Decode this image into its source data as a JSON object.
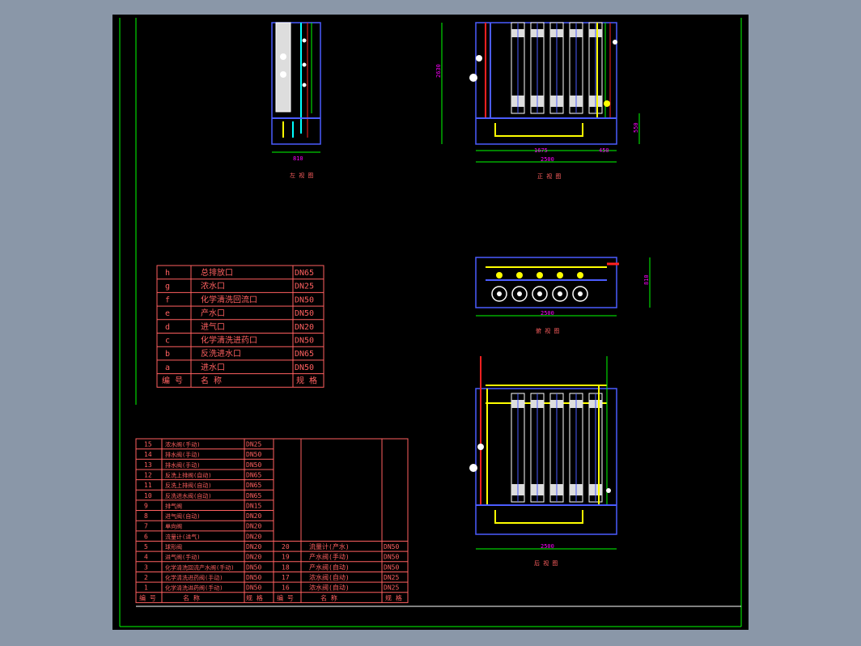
{
  "colors": {
    "background": "#8a97a8",
    "sheet": "#000000",
    "frame": "#00ff00",
    "table": "#ff6060",
    "text": "#ff6060",
    "dim": "#00ff00",
    "dim_text": "#ff00ff",
    "pipe_blue": "#4b5cff",
    "pipe_yellow": "#ffff00",
    "pipe_cyan": "#00ffff",
    "white": "#ffffff"
  },
  "views": {
    "left_view": {
      "title": "左 视 图",
      "dim_width": "810"
    },
    "front_view": {
      "title": "正 视 图",
      "dim_height": "2630",
      "dim_base": "550",
      "dim_a": "1675",
      "dim_b": "450",
      "dim_total": "2500"
    },
    "top_view": {
      "title": "俯 视 图",
      "dim_total": "2500",
      "dim_side": "810"
    },
    "back_view": {
      "title": "后 视 图",
      "dim_total": "2500"
    }
  },
  "interface_table": {
    "header": {
      "code": "编 号",
      "name": "名 称",
      "spec": "规 格"
    },
    "rows": [
      {
        "code": "h",
        "name": "总排放口",
        "spec": "DN65"
      },
      {
        "code": "g",
        "name": "浓水口",
        "spec": "DN25"
      },
      {
        "code": "f",
        "name": "化学清洗回流口",
        "spec": "DN50"
      },
      {
        "code": "e",
        "name": "产水口",
        "spec": "DN50"
      },
      {
        "code": "d",
        "name": "进气口",
        "spec": "DN20"
      },
      {
        "code": "c",
        "name": "化学清洗进药口",
        "spec": "DN50"
      },
      {
        "code": "b",
        "name": "反洗进水口",
        "spec": "DN65"
      },
      {
        "code": "a",
        "name": "进水口",
        "spec": "DN50"
      }
    ]
  },
  "parts_table": {
    "header": {
      "no": "编 号",
      "name": "名 称",
      "spec": "规 格",
      "no2": "编 号",
      "name2": "名 称",
      "spec2": "规 格"
    },
    "left": [
      {
        "no": "15",
        "name": "浓水阀(手动)",
        "spec": "DN25"
      },
      {
        "no": "14",
        "name": "排水阀(手动)",
        "spec": "DN50"
      },
      {
        "no": "13",
        "name": "排水阀(手动)",
        "spec": "DN50"
      },
      {
        "no": "12",
        "name": "反洗上排阀(自动)",
        "spec": "DN65"
      },
      {
        "no": "11",
        "name": "反洗上排阀(自动)",
        "spec": "DN65"
      },
      {
        "no": "10",
        "name": "反洗进水阀(自动)",
        "spec": "DN65"
      },
      {
        "no": "9",
        "name": "排气阀",
        "spec": "DN15"
      },
      {
        "no": "8",
        "name": "进气阀(自动)",
        "spec": "DN20"
      },
      {
        "no": "7",
        "name": "单向阀",
        "spec": "DN20"
      },
      {
        "no": "6",
        "name": "流量计(进气)",
        "spec": "DN20"
      },
      {
        "no": "5",
        "name": "球形阀",
        "spec": "DN20"
      },
      {
        "no": "4",
        "name": "进气阀(手动)",
        "spec": "DN20"
      },
      {
        "no": "3",
        "name": "化学清洗回流产水阀(手动)",
        "spec": "DN50"
      },
      {
        "no": "2",
        "name": "化学清洗进药阀(手动)",
        "spec": "DN50"
      },
      {
        "no": "1",
        "name": "化学清洗进药阀(手动)",
        "spec": "DN50"
      }
    ],
    "right": [
      {
        "no": "20",
        "name": "流量计(产水)",
        "spec": "DN50"
      },
      {
        "no": "19",
        "name": "产水阀(手动)",
        "spec": "DN50"
      },
      {
        "no": "18",
        "name": "产水阀(自动)",
        "spec": "DN50"
      },
      {
        "no": "17",
        "name": "浓水阀(自动)",
        "spec": "DN25"
      },
      {
        "no": "16",
        "name": "浓水阀(自动)",
        "spec": "DN25"
      }
    ]
  }
}
